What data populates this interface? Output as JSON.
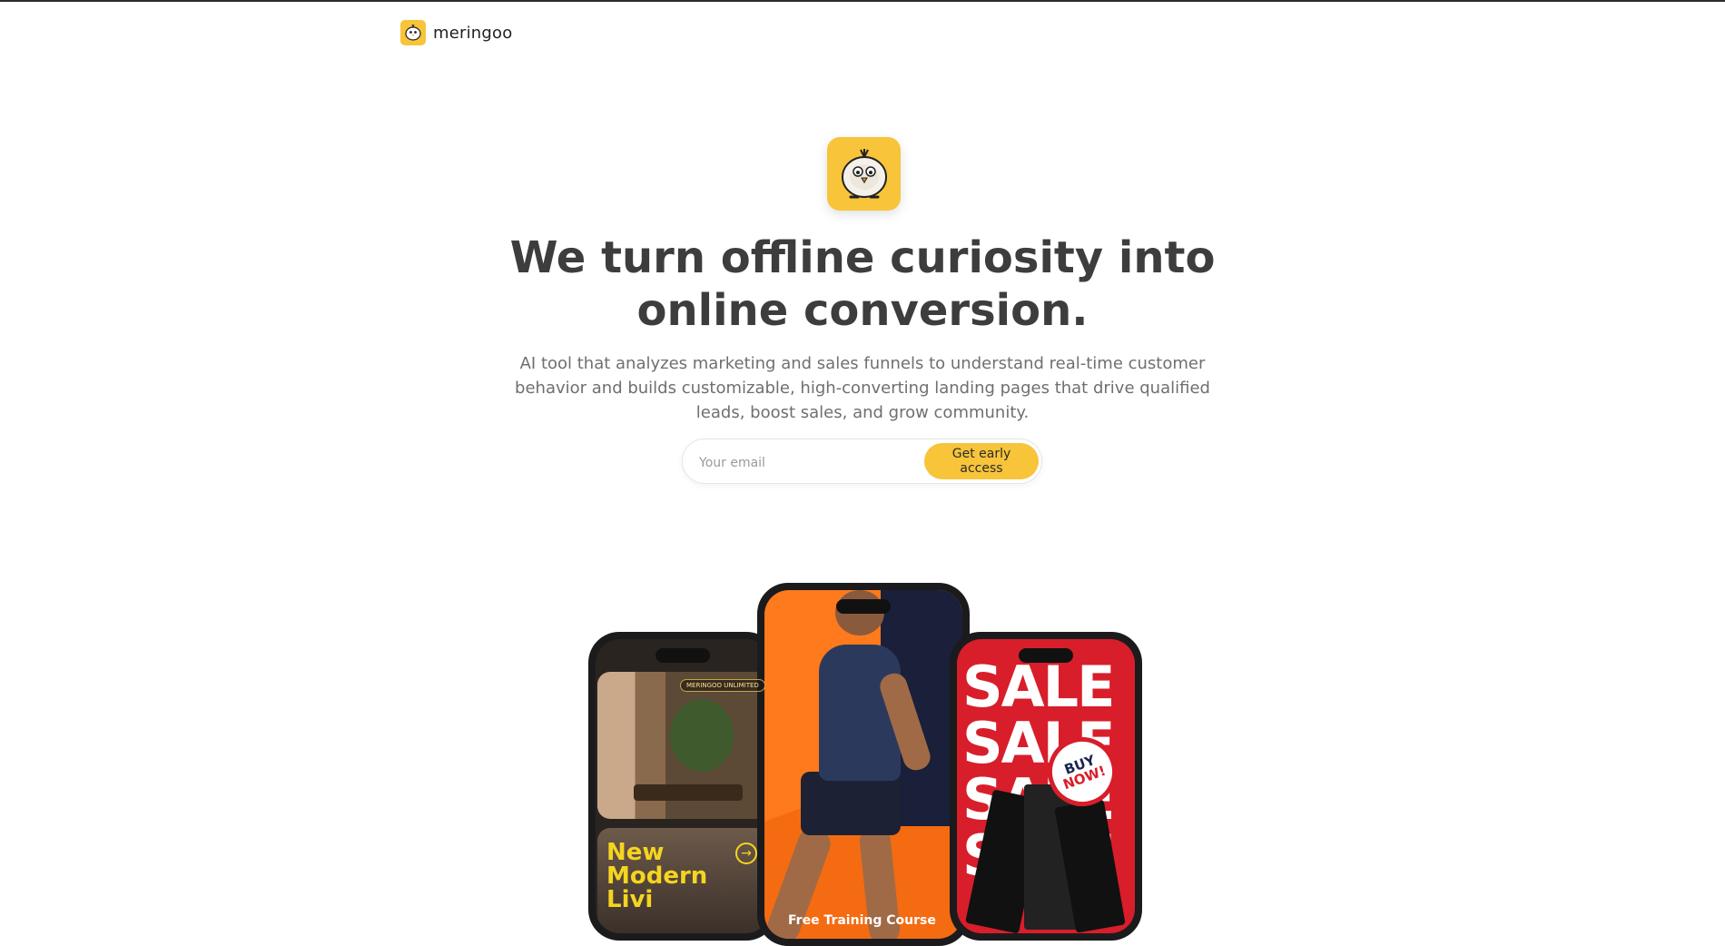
{
  "brand": {
    "name": "meringoo",
    "logo_icon": "chick-mascot-icon",
    "accent_color": "#f7c43a"
  },
  "hero": {
    "headline_line1": "We turn offline curiosity into",
    "headline_line2": "online conversion.",
    "subtext": "AI tool that analyzes marketing and sales funnels to understand real-time customer behavior and builds customizable, high-converting landing pages that drive qualified leads, boost sales, and grow community."
  },
  "signup": {
    "email_placeholder": "Your email",
    "cta_label": "Get early access"
  },
  "phones": {
    "left": {
      "badge": "MERINGOO UNLIMITED",
      "title": "New Modern Livi",
      "arrow_icon": "arrow-right-icon"
    },
    "center": {
      "caption": "Free Training Course"
    },
    "right": {
      "sale_word": "SALE",
      "badge_line1": "BUY",
      "badge_line2": "NOW!"
    }
  }
}
